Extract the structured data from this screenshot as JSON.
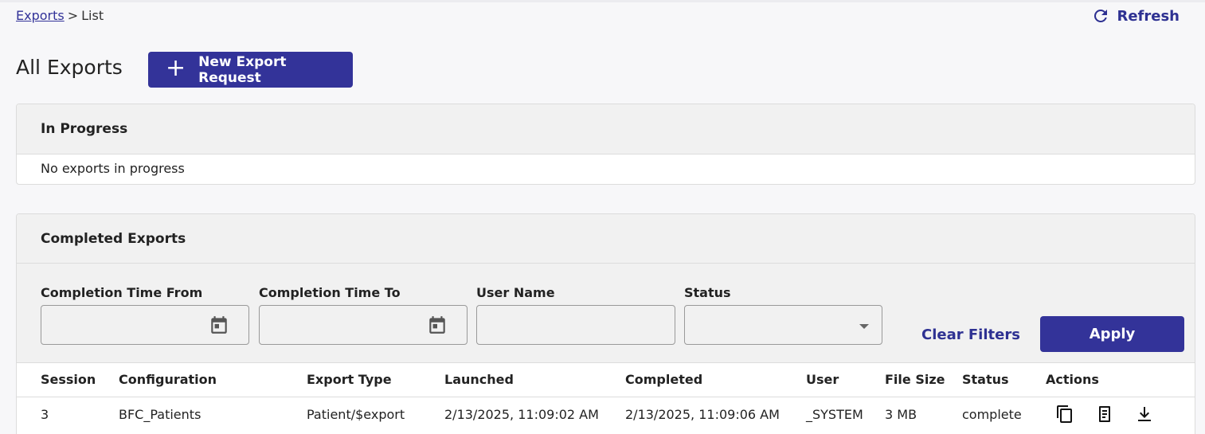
{
  "breadcrumb": {
    "link": "Exports",
    "separator": ">",
    "current": "List"
  },
  "header": {
    "refresh_label": "Refresh",
    "title": "All Exports",
    "new_export_label": "New Export Request"
  },
  "in_progress": {
    "title": "In Progress",
    "empty_message": "No exports in progress"
  },
  "completed": {
    "title": "Completed Exports",
    "filters": {
      "completion_from_label": "Completion Time From",
      "completion_to_label": "Completion Time To",
      "user_name_label": "User Name",
      "status_label": "Status",
      "completion_from_value": "",
      "completion_to_value": "",
      "user_name_value": "",
      "status_value": "",
      "clear_label": "Clear Filters",
      "apply_label": "Apply"
    },
    "columns": [
      "Session",
      "Configuration",
      "Export Type",
      "Launched",
      "Completed",
      "User",
      "File Size",
      "Status",
      "Actions"
    ],
    "rows": [
      {
        "session": "3",
        "configuration": "BFC_Patients",
        "export_type": "Patient/$export",
        "launched": "2/13/2025, 11:09:02 AM",
        "completed": "2/13/2025, 11:09:06 AM",
        "user": "_SYSTEM",
        "file_size": "3 MB",
        "status": "complete",
        "actions": [
          "copy-icon",
          "document-icon",
          "download-icon"
        ]
      }
    ]
  },
  "colors": {
    "accent": "#333399",
    "panel_header_bg": "#f1f1f1",
    "page_bg": "#f7f7f9"
  }
}
